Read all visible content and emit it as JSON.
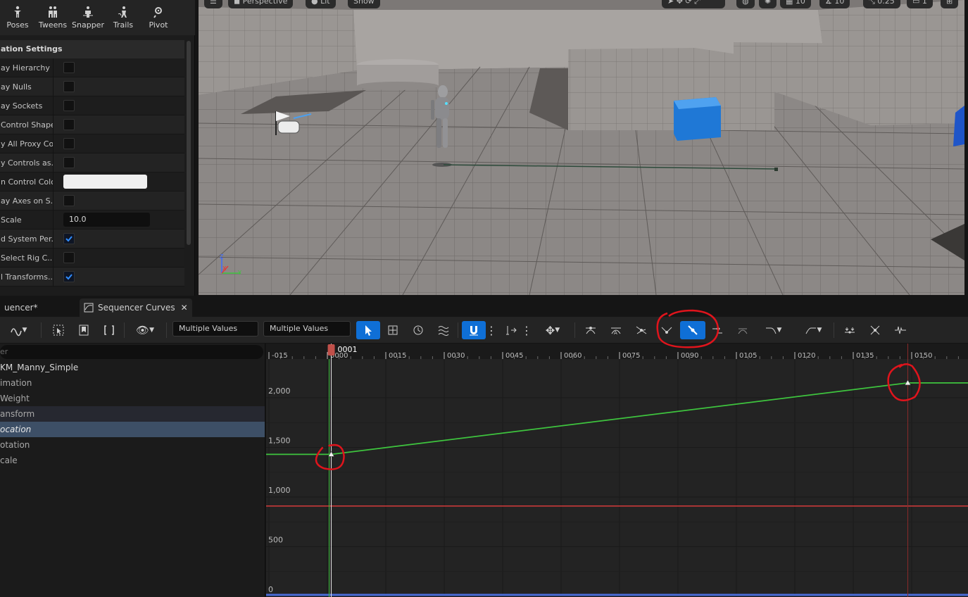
{
  "toolbar_modes": [
    {
      "label": "Poses",
      "icon": "poses-icon"
    },
    {
      "label": "Tweens",
      "icon": "tweens-icon"
    },
    {
      "label": "Snapper",
      "icon": "snapper-icon"
    },
    {
      "label": "Trails",
      "icon": "trails-icon"
    },
    {
      "label": "Pivot",
      "icon": "pivot-icon"
    }
  ],
  "settings": {
    "header": "ation Settings",
    "rows": [
      {
        "label": "ay Hierarchy",
        "type": "checkbox",
        "checked": false
      },
      {
        "label": "ay Nulls",
        "type": "checkbox",
        "checked": false
      },
      {
        "label": "ay Sockets",
        "type": "checkbox",
        "checked": false
      },
      {
        "label": "Control Shapes",
        "type": "checkbox",
        "checked": false
      },
      {
        "label": "y All Proxy Co...",
        "type": "checkbox",
        "checked": false
      },
      {
        "label": "y Controls as...",
        "type": "checkbox",
        "checked": false
      },
      {
        "label": "n Control Color",
        "type": "color",
        "value": "#efefef"
      },
      {
        "label": "ay Axes on S...",
        "type": "checkbox",
        "checked": false
      },
      {
        "label": "Scale",
        "type": "number",
        "value": "10.0"
      },
      {
        "label": "d System Per...",
        "type": "checkbox",
        "checked": true
      },
      {
        "label": "Select Rig C...",
        "type": "checkbox",
        "checked": false
      },
      {
        "label": "l Transforms...",
        "type": "checkbox",
        "checked": true
      }
    ]
  },
  "viewport": {
    "perspective_label": "Perspective",
    "lit_label": "Lit",
    "show_label": "Show",
    "grid_value": "10",
    "rotation_value": "10",
    "scale_value": "0.25",
    "camera_value": "1"
  },
  "tabs": [
    {
      "label": "uencer*"
    },
    {
      "label": "Sequencer Curves"
    }
  ],
  "curve_toolbar": {
    "field_a": "Multiple Values",
    "field_b": "Multiple Values"
  },
  "tree": {
    "search_placeholder": "er",
    "items": [
      "KM_Manny_Simple",
      "imation",
      "Weight",
      "ansform",
      "ocation",
      "otation",
      "cale"
    ]
  },
  "timeline": {
    "current_frame": "0001",
    "ticks": [
      "-015",
      "0000",
      "0015",
      "0030",
      "0045",
      "0060",
      "0075",
      "0090",
      "0105",
      "0120",
      "0135",
      "0150"
    ]
  },
  "graph_axis": {
    "labels": [
      "2,000",
      "1,500",
      "1,000",
      "500",
      "0"
    ]
  },
  "chart_data": {
    "type": "line",
    "xlabel": "",
    "ylabel": "",
    "xlim": [
      -15,
      152
    ],
    "ylim": [
      0,
      2450
    ],
    "x_ticks": [
      -15,
      0,
      15,
      30,
      45,
      60,
      75,
      90,
      105,
      120,
      135,
      150
    ],
    "y_ticks": [
      0,
      500,
      1000,
      1500,
      2000
    ],
    "grid": true,
    "playhead_frame": 1,
    "end_marker_frame": 149,
    "series": [
      {
        "color": "#3ec43e",
        "x": [
          -15,
          1,
          149,
          152
        ],
        "y": [
          1430,
          1430,
          2150,
          2150
        ]
      },
      {
        "color": "#d43a3a",
        "x": [
          -15,
          152
        ],
        "y": [
          910,
          910
        ]
      },
      {
        "color": "#4a6cd8",
        "x": [
          -15,
          152
        ],
        "y": [
          0,
          0
        ]
      }
    ],
    "keys": [
      {
        "x": 1,
        "y": 1430
      },
      {
        "x": 149,
        "y": 2150
      }
    ]
  },
  "colors": {
    "accent": "#0f6fd6",
    "annotation": "#e0141c"
  }
}
